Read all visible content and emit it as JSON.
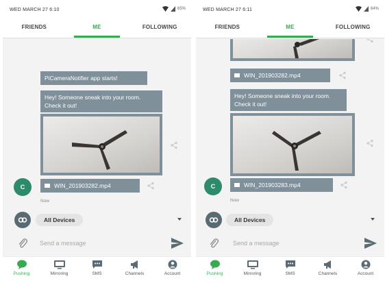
{
  "screens": [
    {
      "status": {
        "time": "WED MARCH 27 6:10",
        "battery": "65%"
      },
      "tabs": [
        {
          "label": "FRIENDS"
        },
        {
          "label": "ME"
        },
        {
          "label": "FOLLOWING"
        }
      ],
      "messages": {
        "notice": "PiCameraNotifier app starts!",
        "alert": "Hey! Someone sneak into your room. Check it out!",
        "file": "WIN_201903282.mp4",
        "avatar_letter": "C",
        "time": "Now"
      },
      "devices": {
        "selected": "All Devices"
      },
      "composer": {
        "placeholder": "Send a message"
      },
      "nav": [
        {
          "label": "Pushing",
          "icon": "pushing-icon"
        },
        {
          "label": "Mirroring",
          "icon": "mirroring-icon"
        },
        {
          "label": "SMS",
          "icon": "sms-icon"
        },
        {
          "label": "Channels",
          "icon": "channels-icon"
        },
        {
          "label": "Account",
          "icon": "account-icon"
        }
      ]
    },
    {
      "status": {
        "time": "WED MARCH 27 6:11",
        "battery": "64%"
      },
      "tabs": [
        {
          "label": "FRIENDS"
        },
        {
          "label": "ME"
        },
        {
          "label": "FOLLOWING"
        }
      ],
      "messages": {
        "file_top": "WIN_201903282.mp4",
        "alert": "Hey! Someone sneak into your room. Check it out!",
        "file": "WIN_201903283.mp4",
        "avatar_letter": "C",
        "time": "Now"
      },
      "devices": {
        "selected": "All Devices"
      },
      "composer": {
        "placeholder": "Send a message"
      },
      "nav": [
        {
          "label": "Pushing",
          "icon": "pushing-icon"
        },
        {
          "label": "Mirroring",
          "icon": "mirroring-icon"
        },
        {
          "label": "SMS",
          "icon": "sms-icon"
        },
        {
          "label": "Channels",
          "icon": "channels-icon"
        },
        {
          "label": "Account",
          "icon": "account-icon"
        }
      ]
    }
  ],
  "colors": {
    "accent": "#3aaa52",
    "bubble": "#7f909a",
    "avatar": "#2d8a6b"
  }
}
